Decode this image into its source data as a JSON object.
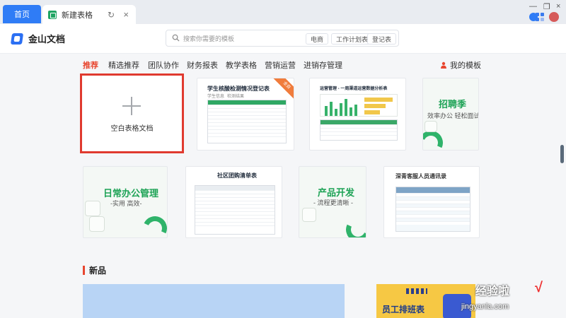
{
  "tabs": {
    "home_label": "首页",
    "doc_label": "新建表格"
  },
  "header": {
    "app_name": "金山文档",
    "search_placeholder": "搜索你需要的模板",
    "search_tags": [
      "电商",
      "工作计划表",
      "登记表"
    ]
  },
  "nav": {
    "items": [
      "推荐",
      "精选推荐",
      "团队协作",
      "财务报表",
      "教学表格",
      "营销运营",
      "进销存管理"
    ],
    "active_index": 0,
    "my_templates": "我的模板"
  },
  "cards": {
    "blank_label": "空白表格文档",
    "student_title": "学生核酸检测情况登记表",
    "student_sub": [
      "学生信息",
      "检测结果"
    ],
    "student_badge": "全自",
    "ops_title": "运营管理 - 一周渠道运营数据分析表",
    "recruit_title": "招聘季",
    "recruit_sub": "效率办公 轻松面试",
    "daily_title": "日常办公管理",
    "daily_sub": "-实用 高效-",
    "group_title": "社区团购清单表",
    "product_title": "产品开发",
    "product_sub": "- 流程更清晰 -",
    "contact_title": "深青客服人员通讯录"
  },
  "section": {
    "new_title": "新品"
  },
  "banners": {
    "schedule_text": "员工排班表"
  },
  "watermark": {
    "main": "经验啦",
    "sub": "jingyanla.com",
    "check": "√"
  },
  "colors": {
    "accent_red": "#e8462f",
    "brand_blue": "#2f7cf6",
    "sheet_green": "#1fa463"
  }
}
